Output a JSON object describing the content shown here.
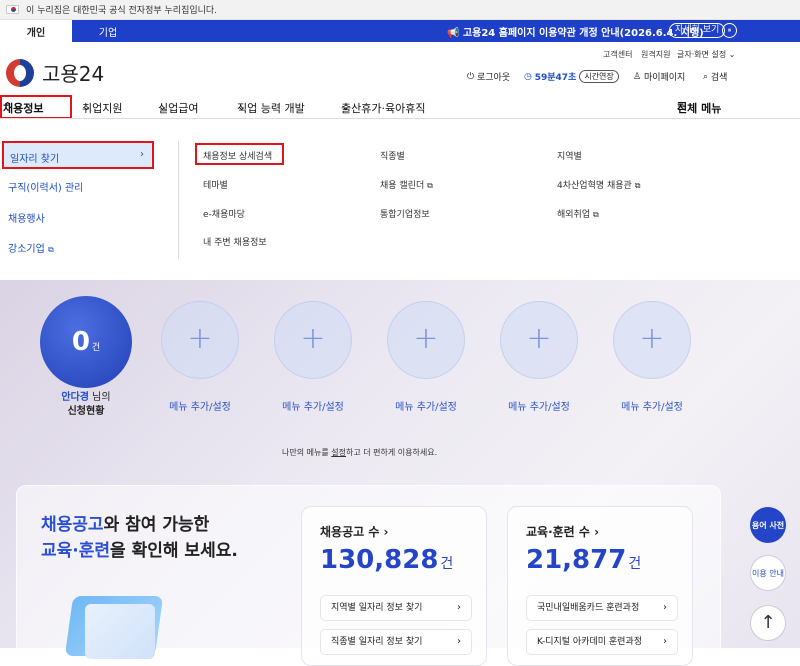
{
  "gov_banner": "이 누리집은 대한민국 공식 전자정부 누리집입니다.",
  "tabs": {
    "personal": "개인",
    "company": "기업"
  },
  "notice": {
    "text": "고용24 홈페이지 이용약관 개정 안내(2026.6.4. 시행)",
    "detail": "자세히 보기",
    "pause": "⏸"
  },
  "util": {
    "customer": "고객센터",
    "remote": "원격지원",
    "display": "글자·화면 설정"
  },
  "logo": "고용24",
  "header": {
    "logout": "로그아웃",
    "timer": "59분47초",
    "extend": "시간연장",
    "mypage": "마이페이지",
    "search": "검색"
  },
  "gnb": [
    "채용정보",
    "취업지원",
    "실업급여",
    "직업 능력 개발",
    "출산휴가·육아휴직"
  ],
  "all_menu": "전체 메뉴",
  "mega": {
    "left": [
      "일자리 찾기",
      "구직(이력서) 관리",
      "채용행사",
      "강소기업"
    ],
    "col1": [
      "채용정보 상세검색",
      "테마별",
      "e-채용마당",
      "내 주변 채용정보"
    ],
    "col2": [
      "직종별",
      "채용 캘린더",
      "통합기업정보"
    ],
    "col3": [
      "지역별",
      "4차산업혁명 채용관",
      "해외취업"
    ]
  },
  "apply": {
    "count": "0",
    "unit": "건",
    "name": "안다경",
    "name_suffix": " 님의",
    "label": "신청현황"
  },
  "menu_add": "메뉴 추가/설정",
  "hint": {
    "pre": "나만의 메뉴를 ",
    "link": "설정",
    "post": "하고 더 편하게 이용하세요."
  },
  "panel": {
    "line1_hl": "채용공고",
    "line1": "와 참여 가능한",
    "line2_hl": "교육·훈련",
    "line2": "을 확인해 보세요."
  },
  "job_card": {
    "title": "채용공고 수 ›",
    "count": "130,828",
    "unit": "건",
    "links": [
      "지역별 일자리 정보 찾기",
      "직종별 일자리 정보 찾기"
    ]
  },
  "edu_card": {
    "title": "교육·훈련 수 ›",
    "count": "21,877",
    "unit": "건",
    "links": [
      "국민내일배움카드 훈련과정",
      "K-디지털 아카데미 훈련과정"
    ]
  },
  "side": {
    "glossary": "용어 사전",
    "guide": "이용 안내"
  },
  "colors": {
    "primary": "#1e3fc7",
    "accent": "#2445c8",
    "highlight": "#e0141b"
  }
}
